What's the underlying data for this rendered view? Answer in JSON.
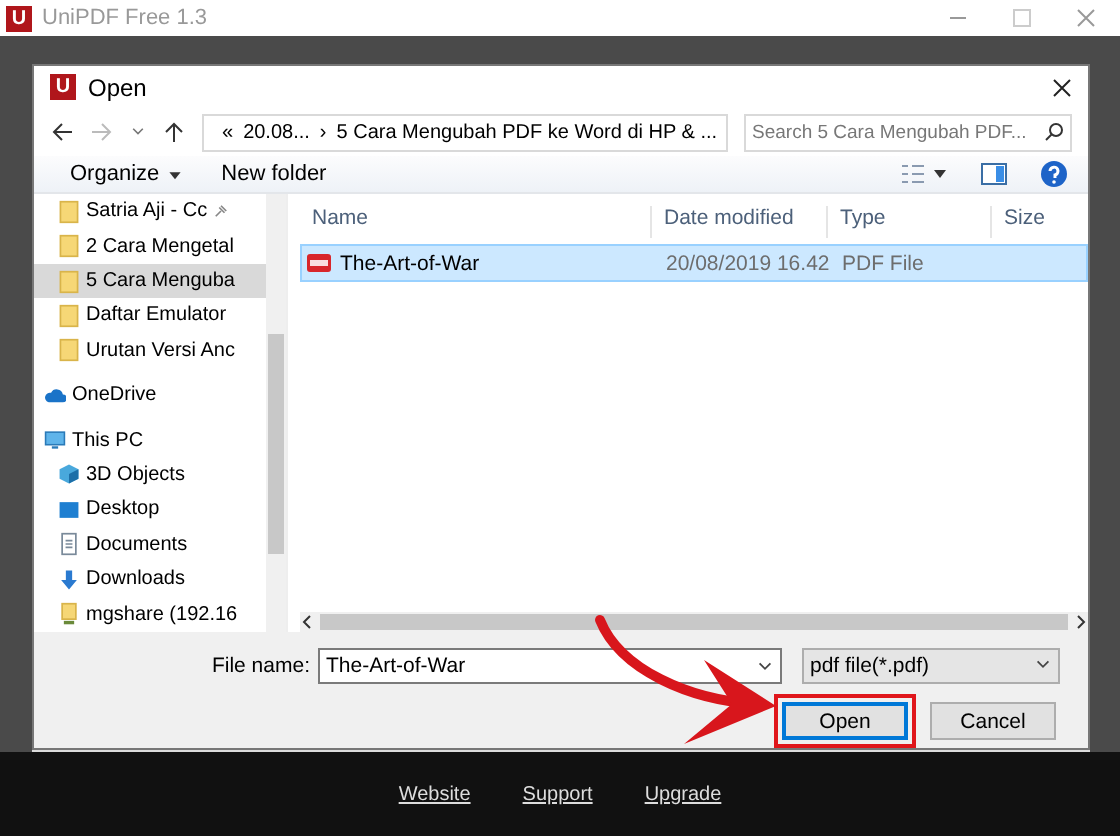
{
  "app": {
    "title": "UniPDF Free 1.3",
    "logo": "U"
  },
  "dialog": {
    "title": "Open",
    "logo": "U",
    "address": {
      "separator": "›",
      "segments": [
        "«",
        "20.08...",
        "5 Cara Mengubah PDF ke Word di HP & ..."
      ]
    },
    "search": {
      "placeholder": "Search 5 Cara Mengubah PDF..."
    },
    "toolbar": [
      "Organize",
      "New folder"
    ],
    "nav": [
      {
        "label": "Satria Aji - Cc",
        "kind": "folder",
        "pinned": true,
        "selected": false
      },
      {
        "label": "2 Cara Mengetal",
        "kind": "folder",
        "pinned": false,
        "selected": false
      },
      {
        "label": "5 Cara Menguba",
        "kind": "folder",
        "pinned": false,
        "selected": true
      },
      {
        "label": "Daftar Emulator",
        "kind": "folder",
        "pinned": false,
        "selected": false
      },
      {
        "label": "Urutan Versi Anc",
        "kind": "folder",
        "pinned": false,
        "selected": false
      },
      {
        "label": "OneDrive",
        "kind": "cloud",
        "pinned": false,
        "selected": false
      },
      {
        "label": "This PC",
        "kind": "pc",
        "pinned": false,
        "selected": false,
        "children": [
          {
            "label": "3D Objects",
            "kind": "cube",
            "pinned": false,
            "selected": false
          },
          {
            "label": "Desktop",
            "kind": "desktop",
            "pinned": false,
            "selected": false
          },
          {
            "label": "Documents",
            "kind": "document",
            "pinned": false,
            "selected": false
          },
          {
            "label": "Downloads",
            "kind": "download",
            "pinned": false,
            "selected": false
          },
          {
            "label": "mgshare (192.16",
            "kind": "network",
            "pinned": false,
            "selected": false
          }
        ]
      }
    ],
    "columns": [
      "Name",
      "Date modified",
      "Type",
      "Size"
    ],
    "rows": [
      {
        "name": "The-Art-of-War",
        "date": "20/08/2019 16.42",
        "type": "PDF File",
        "selected": true
      }
    ],
    "file_name": {
      "label": "File name:",
      "value": "The-Art-of-War"
    },
    "file_type": {
      "value": "pdf file(*.pdf)"
    },
    "buttons": [
      {
        "label": "Open",
        "default": true,
        "highlighted": true
      },
      {
        "label": "Cancel",
        "default": false,
        "highlighted": false
      }
    ]
  },
  "footer": {
    "links": [
      "Website",
      "Support",
      "Upgrade"
    ]
  }
}
